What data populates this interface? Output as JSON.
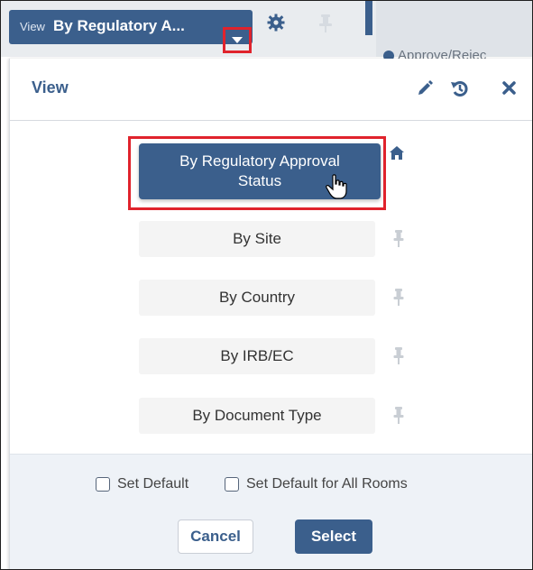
{
  "toolbar": {
    "view_prefix": "View",
    "view_value": "By Regulatory A...",
    "dropdown_caret": "caret-down-icon",
    "settings_icon": "gear-icon",
    "pin_icon": "pin-icon",
    "background_text": "Approve/Rejec"
  },
  "modal": {
    "title": "View",
    "header_icons": [
      "pencil-icon",
      "reset-icon",
      "close-icon"
    ],
    "options": [
      {
        "label": "By Regulatory Approval Status",
        "selected": true,
        "default": true
      },
      {
        "label": "By Site",
        "selected": false
      },
      {
        "label": "By Country",
        "selected": false
      },
      {
        "label": "By IRB/EC",
        "selected": false
      },
      {
        "label": "By Document Type",
        "selected": false
      }
    ],
    "footer": {
      "set_default_label": "Set Default",
      "set_default_all_label": "Set Default for All Rooms",
      "cancel_label": "Cancel",
      "select_label": "Select"
    }
  },
  "colors": {
    "primary": "#3b5f8c",
    "highlight": "#e0232c",
    "footer_bg": "#eef2f7",
    "option_bg": "#f4f4f4"
  }
}
